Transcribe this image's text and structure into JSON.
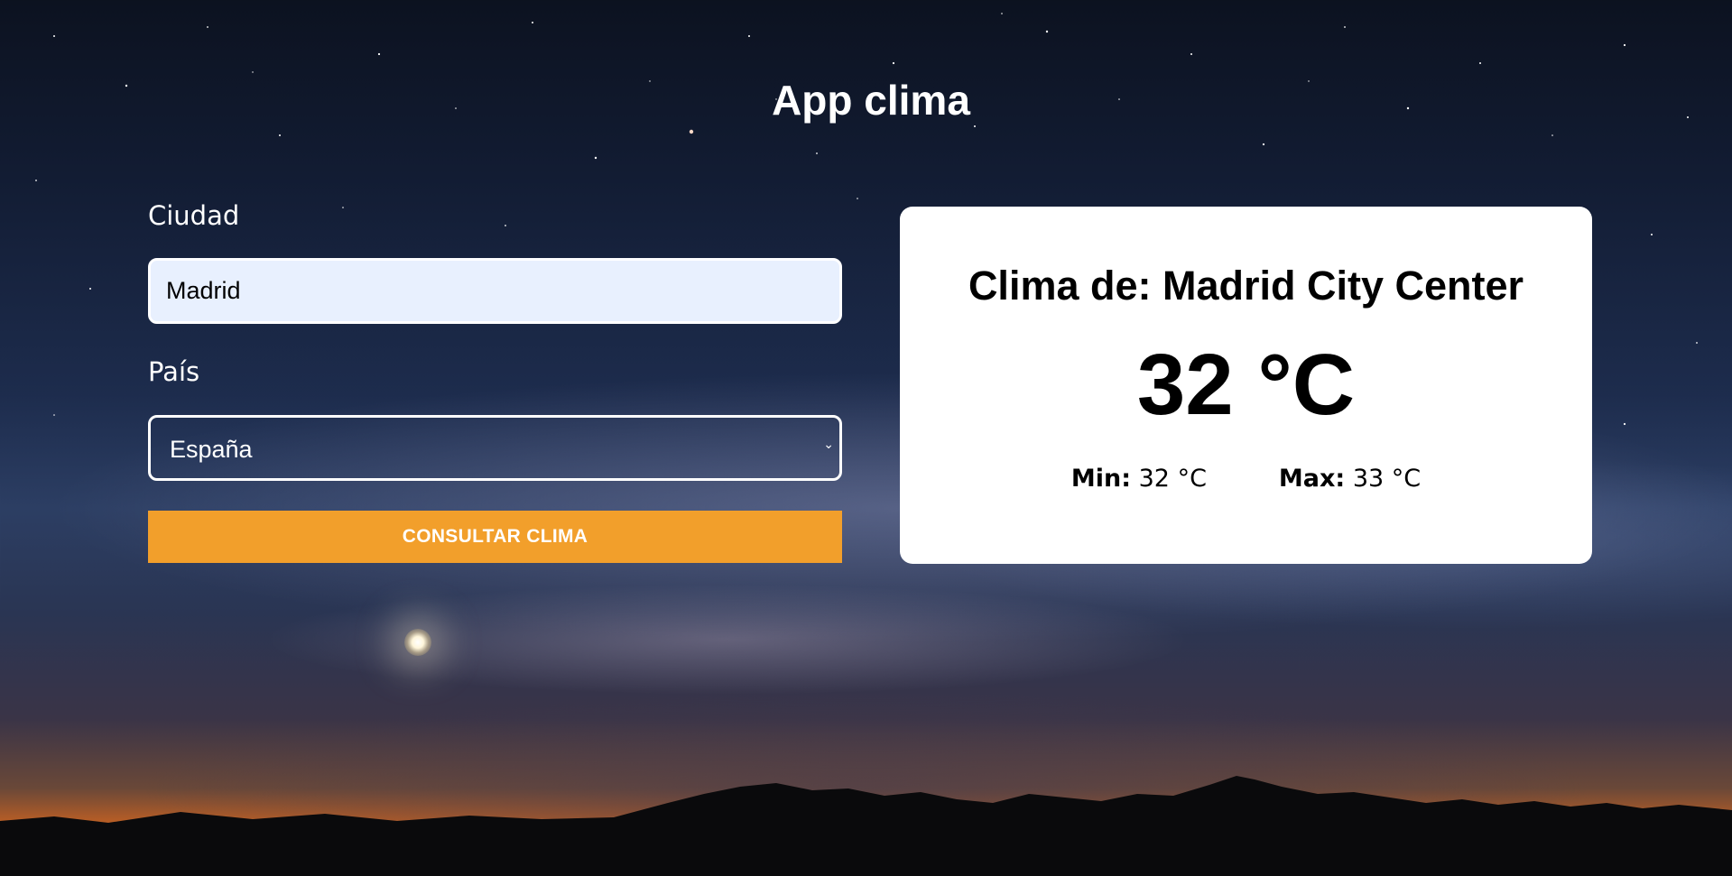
{
  "app": {
    "title": "App clima"
  },
  "form": {
    "city_label": "Ciudad",
    "city_value": "Madrid",
    "country_label": "País",
    "country_selected": "España",
    "submit_label": "CONSULTAR CLIMA"
  },
  "result": {
    "title": "Clima de: Madrid City Center",
    "temperature": "32 °C",
    "min_label": "Min:",
    "min_value": "32 °C",
    "max_label": "Max:",
    "max_value": "33 °C"
  },
  "icons": {
    "select_chevron": "chevron-down-icon"
  },
  "colors": {
    "accent": "#f29f2b",
    "input_bg": "#e8f0fe",
    "card_bg": "#ffffff",
    "text_light": "#ffffff"
  }
}
